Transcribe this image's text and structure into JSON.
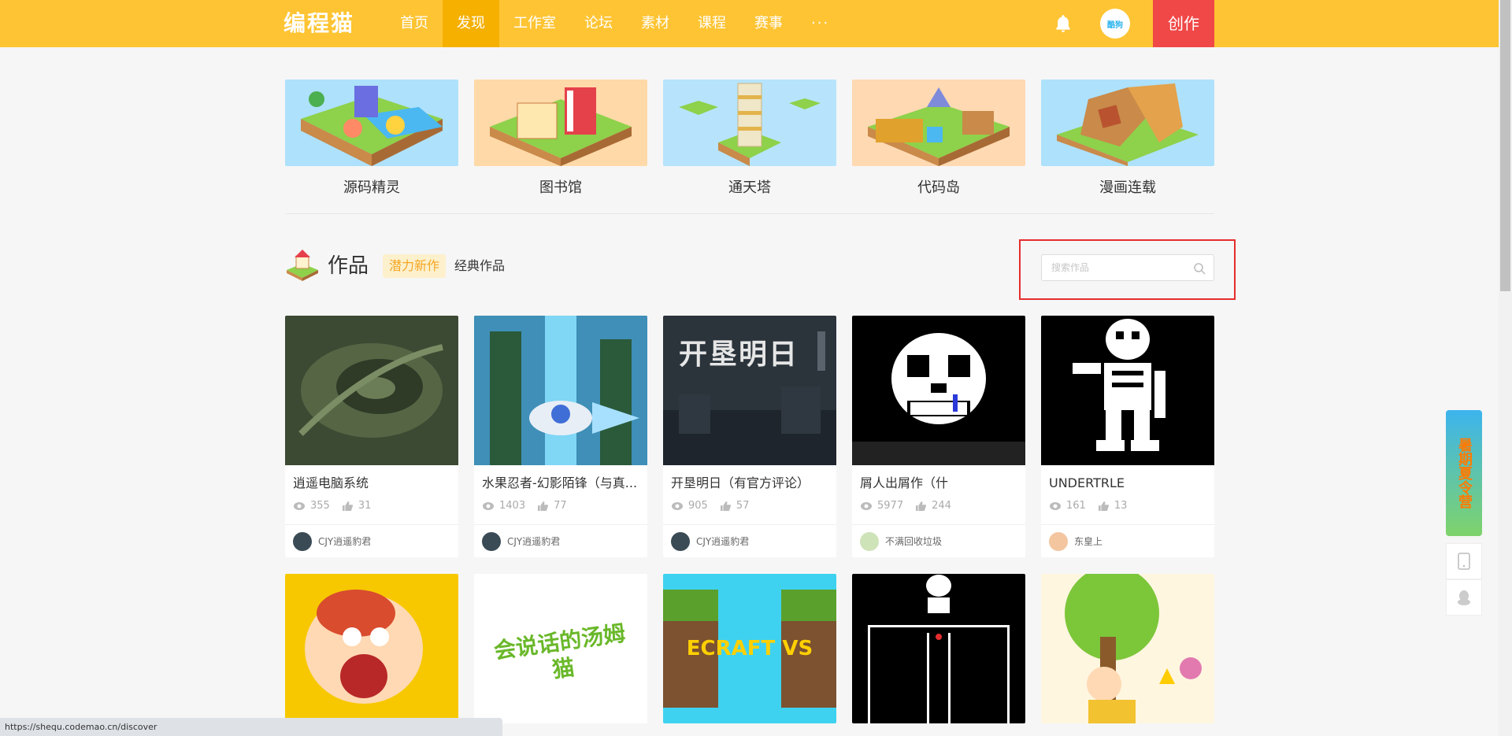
{
  "header": {
    "logo": "编程猫",
    "nav": [
      "首页",
      "发现",
      "工作室",
      "论坛",
      "素材",
      "课程",
      "赛事"
    ],
    "active_index": 1,
    "more": "···",
    "avatar_text": "酷狗",
    "create_label": "创作"
  },
  "categories": [
    {
      "label": "源码精灵",
      "bg": "#aee1fb"
    },
    {
      "label": "图书馆",
      "bg": "#ffd9a8"
    },
    {
      "label": "通天塔",
      "bg": "#b7e4fc"
    },
    {
      "label": "代码岛",
      "bg": "#ffd9b2"
    },
    {
      "label": "漫画连载",
      "bg": "#aee1fb"
    }
  ],
  "works": {
    "title": "作品",
    "tab_new": "潜力新作",
    "tab_classic": "经典作品",
    "search_placeholder": "搜索作品"
  },
  "cards": [
    {
      "title": "逍遥电脑系统",
      "views": "355",
      "likes": "31",
      "author": "CJY逍遥豹君",
      "bg": "#3d4a33"
    },
    {
      "title": "水果忍者-幻影陌锋（与真...",
      "views": "1403",
      "likes": "77",
      "author": "CJY逍遥豹君",
      "bg": "#2f6e9c"
    },
    {
      "title": "开垦明日（有官方评论）",
      "views": "905",
      "likes": "57",
      "author": "CJY逍遥豹君",
      "bg": "#2b333b",
      "img_text": "开垦明日"
    },
    {
      "title": "屑人出屑作（什",
      "views": "5977",
      "likes": "244",
      "author": "不满回收垃圾",
      "bg": "#000000"
    },
    {
      "title": "UNDERTRLE",
      "views": "161",
      "likes": "13",
      "author": "东皇上",
      "bg": "#000000"
    }
  ],
  "cards_row2": [
    {
      "bg": "#f7c800"
    },
    {
      "bg": "#ffffff",
      "img_text": "会说话的汤姆猫"
    },
    {
      "bg": "#3fd2f0",
      "img_text": "ECRAFT VS"
    },
    {
      "bg": "#000000"
    },
    {
      "bg": "#fff6e0"
    }
  ],
  "float": {
    "summer_text": "暑期夏令营"
  },
  "statusbar": "https://shequ.codemao.cn/discover"
}
